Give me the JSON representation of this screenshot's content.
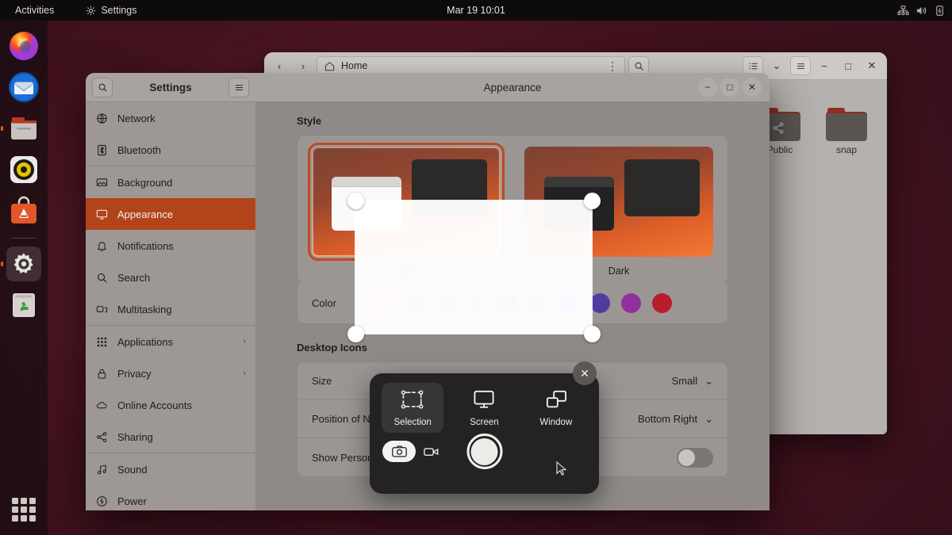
{
  "topbar": {
    "activities": "Activities",
    "app_name": "Settings",
    "clock": "Mar 19  10:01",
    "indicators": [
      "network-icon",
      "volume-icon",
      "battery-icon"
    ]
  },
  "dock": {
    "items": [
      {
        "name": "firefox",
        "label": "Firefox",
        "running": false
      },
      {
        "name": "thunderbird",
        "label": "Thunderbird",
        "running": false
      },
      {
        "name": "files",
        "label": "Files",
        "running": true
      },
      {
        "name": "rhythmbox",
        "label": "Rhythmbox",
        "running": false
      },
      {
        "name": "ubuntu-software",
        "label": "Ubuntu Software",
        "running": false
      },
      {
        "name": "settings",
        "label": "Settings",
        "running": true
      },
      {
        "name": "trash",
        "label": "Trash",
        "running": false
      }
    ],
    "show_applications": "Show Applications"
  },
  "files_window": {
    "path": "Home",
    "home_icon": "home-icon",
    "menu_icon": "vertical-dots-icon",
    "search_icon": "search-icon",
    "view_icon": "list-view-icon",
    "chevron_icon": "chevron-down-icon",
    "hamburger_icon": "hamburger-icon",
    "controls": {
      "minimize": "−",
      "maximize": "□",
      "close": "✕"
    },
    "files": [
      {
        "label": "Public",
        "icon": "shared-folder-icon"
      },
      {
        "label": "snap",
        "icon": "folder-icon"
      }
    ]
  },
  "settings_window": {
    "title": "Settings",
    "search_icon": "search-icon",
    "menu_icon": "hamburger-icon",
    "page_title": "Appearance",
    "controls": {
      "minimize": "−",
      "maximize": "□",
      "close": "✕"
    },
    "sidebar": [
      {
        "label": "Network",
        "icon": "network-icon",
        "selected": false,
        "chevron": ""
      },
      {
        "label": "Bluetooth",
        "icon": "bluetooth-icon",
        "selected": false,
        "chevron": ""
      },
      {
        "label": "Background",
        "icon": "background-icon",
        "selected": false,
        "chevron": ""
      },
      {
        "label": "Appearance",
        "icon": "appearance-icon",
        "selected": true,
        "chevron": ""
      },
      {
        "label": "Notifications",
        "icon": "bell-icon",
        "selected": false,
        "chevron": ""
      },
      {
        "label": "Search",
        "icon": "search-icon",
        "selected": false,
        "chevron": ""
      },
      {
        "label": "Multitasking",
        "icon": "multitasking-icon",
        "selected": false,
        "chevron": ""
      },
      {
        "label": "Applications",
        "icon": "grid-icon",
        "selected": false,
        "chevron": "›"
      },
      {
        "label": "Privacy",
        "icon": "lock-icon",
        "selected": false,
        "chevron": "›"
      },
      {
        "label": "Online Accounts",
        "icon": "cloud-icon",
        "selected": false,
        "chevron": ""
      },
      {
        "label": "Sharing",
        "icon": "share-icon",
        "selected": false,
        "chevron": ""
      },
      {
        "label": "Sound",
        "icon": "sound-icon",
        "selected": false,
        "chevron": ""
      },
      {
        "label": "Power",
        "icon": "power-icon",
        "selected": false,
        "chevron": ""
      }
    ],
    "style_section": {
      "heading": "Style",
      "options": [
        {
          "label": "Light",
          "selected": true
        },
        {
          "label": "Dark",
          "selected": false
        }
      ]
    },
    "color_section": {
      "label": "Color",
      "swatches": [
        {
          "name": "orange",
          "hex": "#e95420",
          "selected": true
        },
        {
          "name": "olive",
          "hex": "#787a5a"
        },
        {
          "name": "slate-green",
          "hex": "#5f7168"
        },
        {
          "name": "green",
          "hex": "#4e9a06"
        },
        {
          "name": "emerald",
          "hex": "#108b60"
        },
        {
          "name": "teal",
          "hex": "#2e8287"
        },
        {
          "name": "blue",
          "hex": "#1b72d8"
        },
        {
          "name": "indigo",
          "hex": "#4f3d9e"
        },
        {
          "name": "purple",
          "hex": "#92309b"
        },
        {
          "name": "red",
          "hex": "#b81d2e"
        }
      ]
    },
    "desktop_icons_section": {
      "heading": "Desktop Icons",
      "rows": [
        {
          "label": "Size",
          "value": "Small",
          "control": "dropdown"
        },
        {
          "label": "Position of New Icons",
          "value": "Bottom Right",
          "control": "dropdown"
        },
        {
          "label": "Show Personal Folder",
          "value": "off",
          "control": "toggle"
        }
      ]
    }
  },
  "screenshot_tool": {
    "modes": [
      {
        "label": "Selection",
        "icon": "selection-icon",
        "active": true
      },
      {
        "label": "Screen",
        "icon": "screen-icon",
        "active": false
      },
      {
        "label": "Window",
        "icon": "window-icon",
        "active": false
      }
    ],
    "capture_kind": [
      {
        "name": "screenshot",
        "icon": "camera-icon",
        "active": true
      },
      {
        "name": "screencast",
        "icon": "video-camera-icon",
        "active": false
      }
    ],
    "shutter": "capture-button",
    "close": "✕"
  },
  "colors": {
    "accent": "#e95420",
    "selection_highlight": "#b3441a",
    "topbar_bg": "#0d0b0b",
    "window_bg": "#8f8a87"
  }
}
